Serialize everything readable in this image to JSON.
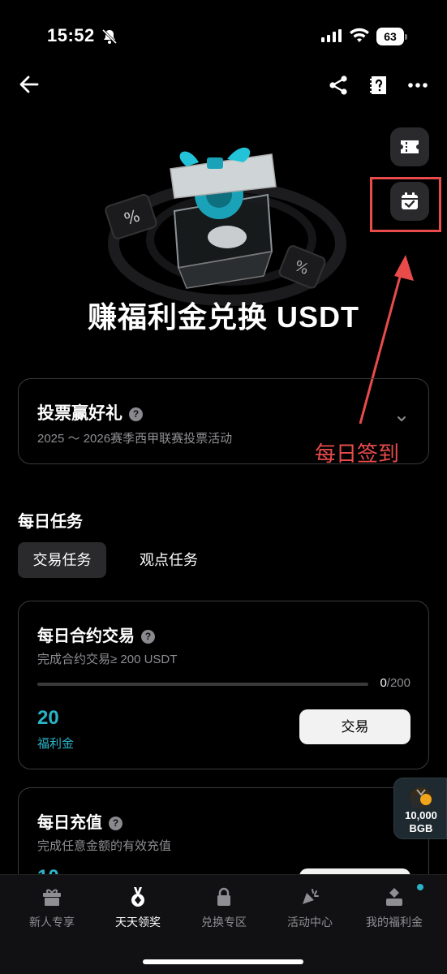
{
  "status_bar": {
    "time": "15:52",
    "battery": "63"
  },
  "hero": {
    "title": "赚福利金兑换 USDT"
  },
  "annotation": {
    "label": "每日签到",
    "color": "#e94b4b"
  },
  "vote_card": {
    "title": "投票赢好礼",
    "subtitle": "2025 ～ 2026赛季西甲联赛投票活动"
  },
  "daily_tasks": {
    "title": "每日任务",
    "tabs": [
      {
        "label": "交易任务",
        "active": true
      },
      {
        "label": "观点任务",
        "active": false
      }
    ],
    "cards": [
      {
        "title": "每日合约交易",
        "subtitle": "完成合约交易≥ 200 USDT",
        "progress_current": "0",
        "progress_total": "/200",
        "progress_fraction": 0,
        "reward_value": "20",
        "reward_unit": "福利金",
        "button_label": "交易"
      },
      {
        "title": "每日充值",
        "subtitle": "完成任意金额的有效充值",
        "reward_value": "10"
      }
    ]
  },
  "floating_badge": {
    "amount": "10,000",
    "currency": "BGB"
  },
  "bottom_nav": {
    "items": [
      {
        "label": "新人专享",
        "icon": "gift-icon"
      },
      {
        "label": "天天领奖",
        "icon": "medal-icon",
        "active": true
      },
      {
        "label": "兑换专区",
        "icon": "lock-icon"
      },
      {
        "label": "活动中心",
        "icon": "megaphone-icon"
      },
      {
        "label": "我的福利金",
        "icon": "wallet-icon"
      }
    ]
  },
  "colors": {
    "accent": "#2ab4c8",
    "background": "#000000",
    "card_border": "#3a3a3c"
  }
}
